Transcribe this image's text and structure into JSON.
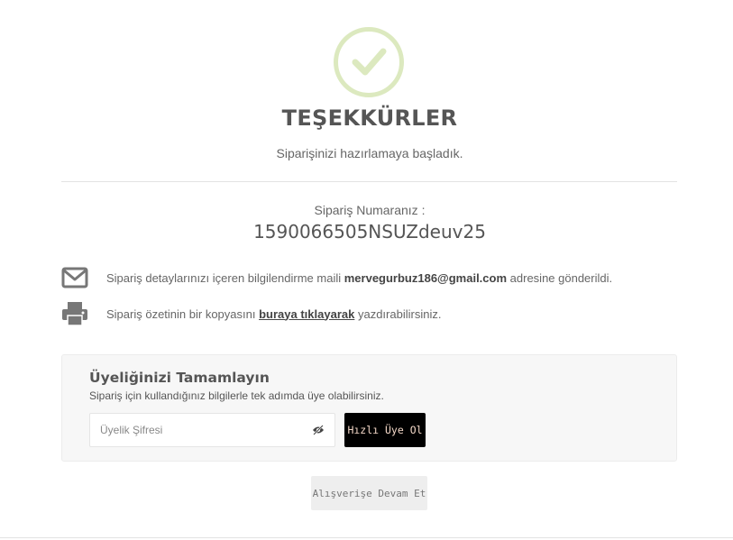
{
  "success": {
    "icon": "check-circle-icon",
    "title": "TEŞEKKÜRLER",
    "subtitle": "Siparişinizi hazırlamaya başladık."
  },
  "order": {
    "label": "Sipariş Numaranız :",
    "number": "1590066505NSUZdeuv25"
  },
  "email_info": {
    "icon": "envelope-icon",
    "text_before": "Sipariş detaylarınızı içeren bilgilendirme maili",
    "email": "mervegurbuz186@gmail.com",
    "text_after": "adresine gönderildi."
  },
  "print_info": {
    "icon": "printer-icon",
    "text_before": "Sipariş özetinin bir kopyasını",
    "link": "buraya tıklayarak",
    "text_after": "yazdırabilirsiniz."
  },
  "membership": {
    "title": "Üyeliğinizi Tamamlayın",
    "description": "Sipariş için kullandığınız bilgilerle tek adımda üye olabilirsiniz.",
    "password_placeholder": "Üyelik Şifresi",
    "password_value": "",
    "toggle_icon": "eye-slash-icon",
    "button_label": "Hızlı Üye Ol"
  },
  "continue_button": "Alışverişe Devam Et",
  "colors": {
    "check_accent": "#dce9bf",
    "button_dark": "#000000",
    "button_dark_text": "#f2d7c7",
    "button_light": "#eeeeee"
  }
}
